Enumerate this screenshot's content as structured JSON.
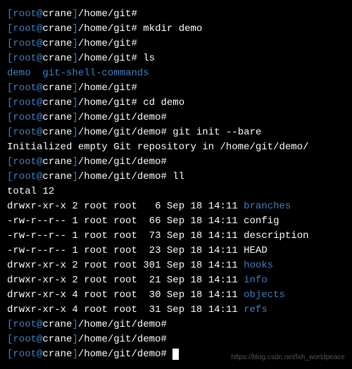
{
  "prompt_user": "root",
  "prompt_host": "crane",
  "lines": [
    {
      "type": "prompt",
      "path": "/home/git",
      "cmd": ""
    },
    {
      "type": "prompt",
      "path": "/home/git",
      "cmd": "mkdir demo"
    },
    {
      "type": "prompt",
      "path": "/home/git",
      "cmd": ""
    },
    {
      "type": "prompt",
      "path": "/home/git",
      "cmd": "ls"
    },
    {
      "type": "ls-output",
      "items": [
        {
          "name": "demo",
          "is_dir": true
        },
        {
          "name": "git-shell-commands",
          "is_dir": true
        }
      ]
    },
    {
      "type": "prompt",
      "path": "/home/git",
      "cmd": ""
    },
    {
      "type": "prompt",
      "path": "/home/git",
      "cmd": "cd demo"
    },
    {
      "type": "prompt",
      "path": "/home/git/demo",
      "cmd": ""
    },
    {
      "type": "prompt",
      "path": "/home/git/demo",
      "cmd": "git init --bare"
    },
    {
      "type": "output",
      "text": "Initialized empty Git repository in /home/git/demo/"
    },
    {
      "type": "prompt",
      "path": "/home/git/demo",
      "cmd": ""
    },
    {
      "type": "prompt",
      "path": "/home/git/demo",
      "cmd": "ll"
    },
    {
      "type": "output",
      "text": "total 12"
    },
    {
      "type": "ll",
      "perms": "drwxr-xr-x",
      "links": "2",
      "owner": "root",
      "group": "root",
      "size": "6",
      "date": "Sep 18 14:11",
      "name": "branches",
      "is_dir": true
    },
    {
      "type": "ll",
      "perms": "-rw-r--r--",
      "links": "1",
      "owner": "root",
      "group": "root",
      "size": "66",
      "date": "Sep 18 14:11",
      "name": "config",
      "is_dir": false
    },
    {
      "type": "ll",
      "perms": "-rw-r--r--",
      "links": "1",
      "owner": "root",
      "group": "root",
      "size": "73",
      "date": "Sep 18 14:11",
      "name": "description",
      "is_dir": false
    },
    {
      "type": "ll",
      "perms": "-rw-r--r--",
      "links": "1",
      "owner": "root",
      "group": "root",
      "size": "23",
      "date": "Sep 18 14:11",
      "name": "HEAD",
      "is_dir": false
    },
    {
      "type": "ll",
      "perms": "drwxr-xr-x",
      "links": "2",
      "owner": "root",
      "group": "root",
      "size": "301",
      "date": "Sep 18 14:11",
      "name": "hooks",
      "is_dir": true
    },
    {
      "type": "ll",
      "perms": "drwxr-xr-x",
      "links": "2",
      "owner": "root",
      "group": "root",
      "size": "21",
      "date": "Sep 18 14:11",
      "name": "info",
      "is_dir": true
    },
    {
      "type": "ll",
      "perms": "drwxr-xr-x",
      "links": "4",
      "owner": "root",
      "group": "root",
      "size": "30",
      "date": "Sep 18 14:11",
      "name": "objects",
      "is_dir": true
    },
    {
      "type": "ll",
      "perms": "drwxr-xr-x",
      "links": "4",
      "owner": "root",
      "group": "root",
      "size": "31",
      "date": "Sep 18 14:11",
      "name": "refs",
      "is_dir": true
    },
    {
      "type": "prompt",
      "path": "/home/git/demo",
      "cmd": ""
    },
    {
      "type": "prompt",
      "path": "/home/git/demo",
      "cmd": ""
    },
    {
      "type": "prompt",
      "path": "/home/git/demo",
      "cmd": "",
      "cursor": true
    }
  ],
  "watermark": "https://blog.csdn.net/lxh_worldpeace"
}
